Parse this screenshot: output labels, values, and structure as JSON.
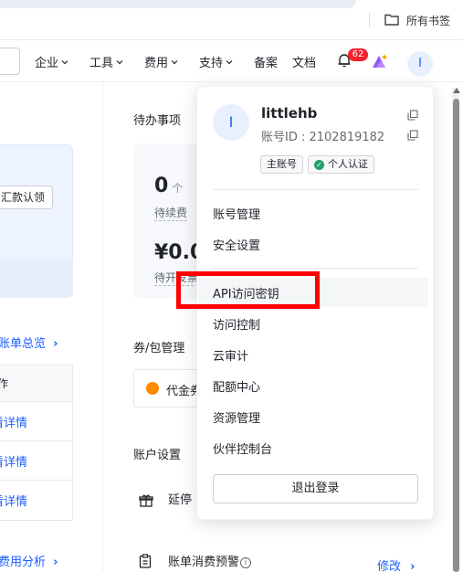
{
  "browser": {
    "bookmarks_label": "所有书签"
  },
  "nav": {
    "items": [
      "企业",
      "工具",
      "费用",
      "支持",
      "备案",
      "文档"
    ],
    "notification_count": "62",
    "avatar_letter": "I"
  },
  "left": {
    "claim_button": "汇款认领",
    "bill_overview_link": "账单总览",
    "table_header": "作",
    "detail_rows": [
      "看详情",
      "看详情",
      "看详情"
    ],
    "cost_analysis_link": "费用分析"
  },
  "middle": {
    "todo_title": "待办事项",
    "renew_count": "0",
    "renew_unit": "个",
    "renew_label": "待续费",
    "invoice_amount": "¥0.0",
    "invoice_label": "待开发票",
    "coupon_title": "券/包管理",
    "coupon_label": "代金券",
    "account_settings_title": "账户设置",
    "delay_label": "延停",
    "bill_alert_label": "账单消费预警",
    "modify_link": "修改"
  },
  "dropdown": {
    "avatar_letter": "I",
    "username": "littlehb",
    "account_id": "账号ID : 2102819182",
    "tag_main": "主账号",
    "tag_verified": "个人认证",
    "menu_group1": [
      "账号管理",
      "安全设置"
    ],
    "menu_group2": [
      "API访问密钥",
      "访问控制",
      "云审计",
      "配额中心",
      "资源管理",
      "伙伴控制台"
    ],
    "logout_label": "退出登录"
  },
  "colors": {
    "accent": "#1a5fff",
    "badge": "#f5222d",
    "highlight_box": "#ff0000"
  }
}
